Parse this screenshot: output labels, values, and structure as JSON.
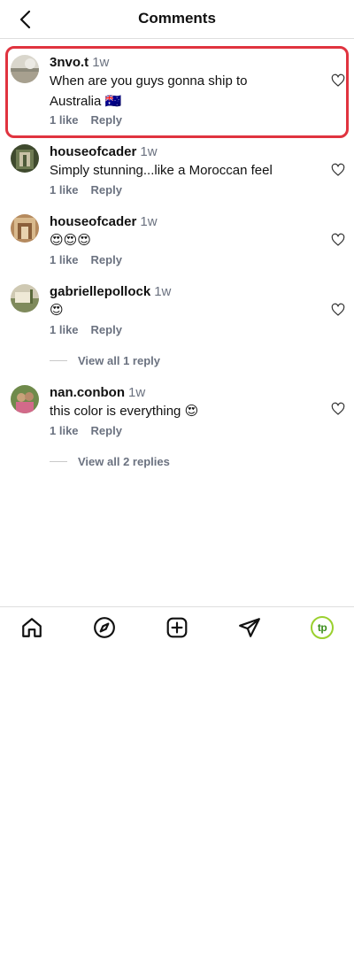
{
  "header": {
    "title": "Comments"
  },
  "comments": [
    {
      "user": "3nvo.t",
      "time": "1w",
      "text_line1": "When are you guys gonna ship to",
      "text_line2": "Australia 🇦🇺",
      "likes": "1 like",
      "reply": "Reply"
    },
    {
      "user": "houseofcader",
      "time": "1w",
      "text": "Simply stunning...like a Moroccan feel",
      "likes": "1 like",
      "reply": "Reply"
    },
    {
      "user": "houseofcader",
      "time": "1w",
      "text": "😍😍😍",
      "likes": "1 like",
      "reply": "Reply"
    },
    {
      "user": "gabriellepollock",
      "time": "1w",
      "text": "😍",
      "likes": "1 like",
      "reply": "Reply",
      "view_replies": "View all 1 reply"
    },
    {
      "user": "nan.conbon",
      "time": "1w",
      "text": "this color is everything 😍",
      "likes": "1 like",
      "reply": "Reply",
      "view_replies": "View all 2 replies"
    }
  ],
  "tabbar": {
    "items": [
      "home-icon",
      "explore-icon",
      "create-icon",
      "direct-icon",
      "profile-avatar"
    ],
    "profile_initials": "tp"
  },
  "colors": {
    "highlight": "#e0333f",
    "profile_ring": "#9ad02e"
  }
}
